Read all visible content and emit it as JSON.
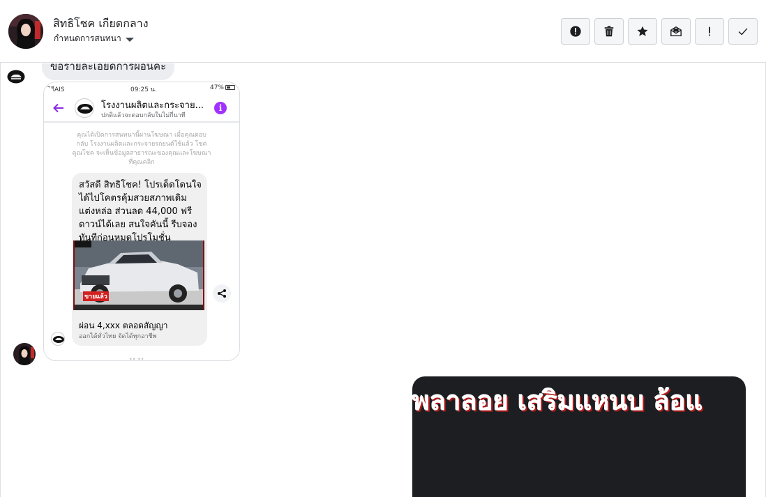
{
  "header": {
    "contact_name": "สิทธิโชค เกียดกลาง",
    "conversation_settings": "กำหนดการสนทนา",
    "toolbar": [
      {
        "name": "report-icon",
        "label": ""
      },
      {
        "name": "trash-icon",
        "label": ""
      },
      {
        "name": "star-icon",
        "label": ""
      },
      {
        "name": "mark-unread-icon",
        "label": ""
      },
      {
        "name": "important-icon",
        "label": ""
      },
      {
        "name": "checkmark-icon",
        "label": ""
      }
    ]
  },
  "thread": {
    "message_text": "ขอรายละเอียดการผ่อนค่ะ",
    "screenshot": {
      "status_left": "ิาีAIS",
      "status_time": "09:25 น.",
      "status_right": "47%",
      "page_name": "โรงงานผลิตและกระจาย...",
      "page_subtitle": "ปกติแล้วจะตอบกลับในไม่กี่นาที",
      "notice": "คุณได้เปิดการสนทนานี้ผ่านโฆษณา เมื่อคุณตอบกลับ โรงงานผลิตและกระจายรถยนต์ใช้แล้ว โชคคูณโชค จะเห็นข้อมูลสาธารณะของคุณและโฆษณาที่คุณคลิก",
      "card_text": "สวัสดี สิทธิโชค! โปรเด็ดโดนใจ ได้ไปโคตรคุ้มสวยสภาพเดิม แต่งหล่อ ส่วนลด 44,000 ฟรีดาวน์ได้เลย สนใจคันนี้ รีบจองทันทีก่อนหมดโปรโมชั่น",
      "car_badge": "ขายแล้ว",
      "card_title": "ผ่อน 4,xxx ตลอดสัญญา",
      "card_subtitle": "ออกได้ทั่วไทย จัดได้ทุกอาชีพ"
    },
    "promo_text": "พลาลอย เสริมแหนบ ล้อแ"
  }
}
